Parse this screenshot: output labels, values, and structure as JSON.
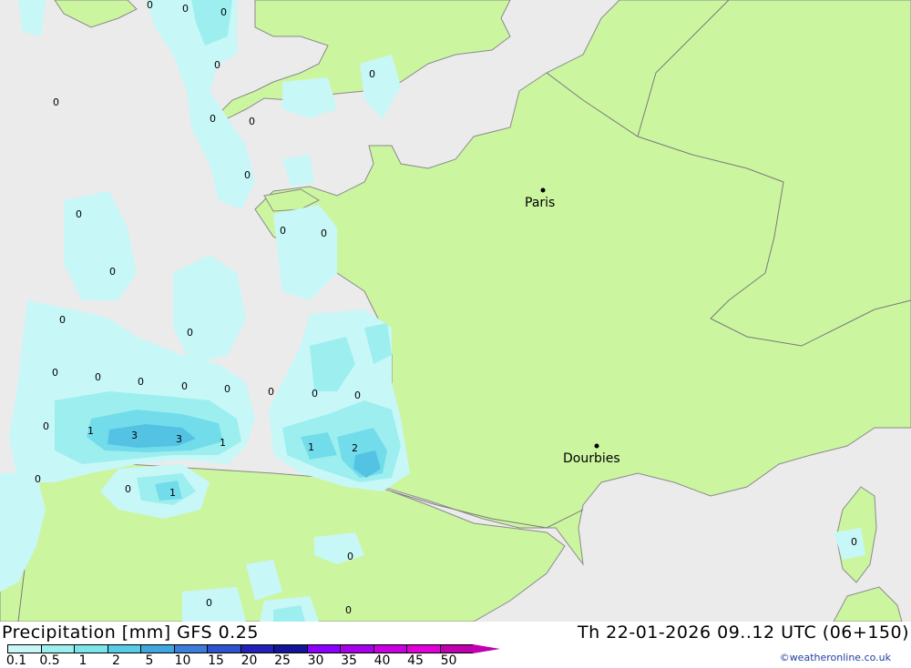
{
  "map": {
    "cities": [
      {
        "name": "Paris"
      },
      {
        "name": "Dourbies"
      }
    ],
    "values": [
      "0",
      "0",
      "0",
      "0",
      "0",
      "0",
      "0",
      "0",
      "0",
      "0",
      "0",
      "0",
      "0",
      "0",
      "0",
      "0",
      "0",
      "0",
      "0",
      "0",
      "0",
      "0",
      "0",
      "0",
      "0",
      "0",
      "0",
      "0",
      "0",
      "0",
      "0",
      "0",
      "1",
      "3",
      "3",
      "1",
      "1",
      "2",
      "1",
      "0",
      "0",
      "0",
      "0",
      "0"
    ],
    "colors": {
      "sea": "#ebebeb",
      "land": "#ccf5a0",
      "border": "#7a7a7a",
      "precip_0_1": "#c8f7f7",
      "precip_0_5": "#9defef",
      "precip_1": "#73dcea",
      "precip_2": "#54c2e3"
    }
  },
  "footer": {
    "title": "Precipitation [mm] GFS 0.25",
    "timestamp": "Th 22-01-2026 09..12 UTC (06+150)",
    "credit": "©weatheronline.co.uk"
  },
  "legend": {
    "labels": [
      "0.1",
      "0.5",
      "1",
      "2",
      "5",
      "10",
      "15",
      "20",
      "25",
      "30",
      "35",
      "40",
      "45",
      "50"
    ],
    "colors": [
      "#c8f7f7",
      "#9defef",
      "#7ae6ea",
      "#56cce6",
      "#3fa6e0",
      "#3a7ddb",
      "#2f52d1",
      "#2222b8",
      "#14149a",
      "#8b00ff",
      "#a600e8",
      "#c800e0",
      "#e000d8",
      "#c000b0"
    ]
  }
}
